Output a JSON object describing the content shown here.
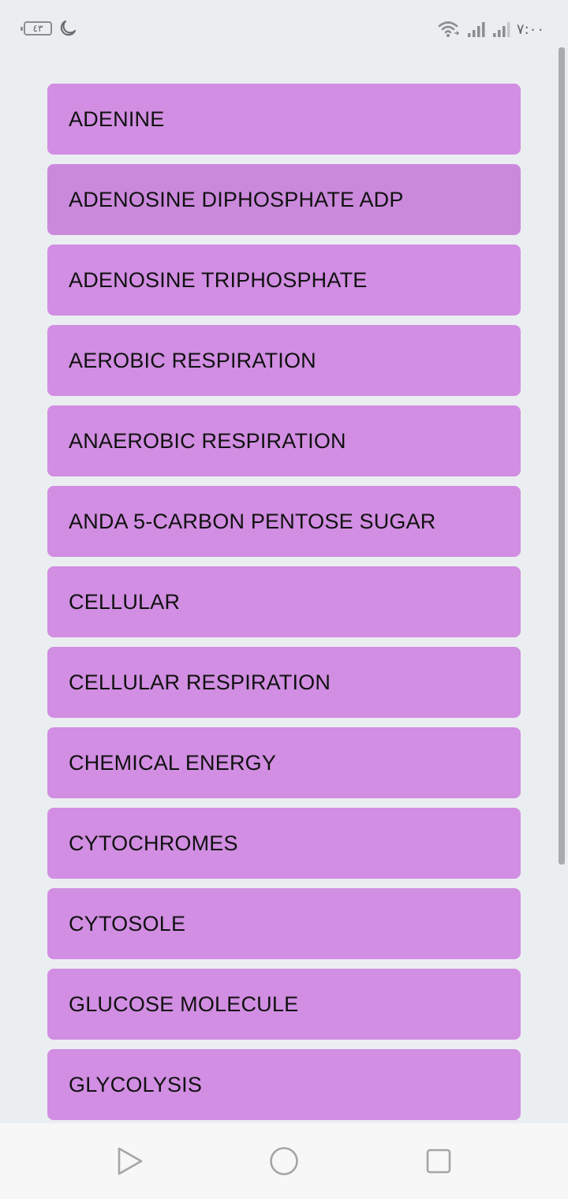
{
  "status_bar": {
    "battery_level": "٤٣",
    "time": "٧:٠٠",
    "icons": [
      "moon-icon",
      "wifi-icon",
      "signal-icon",
      "signal-icon"
    ]
  },
  "list": {
    "items": [
      "ADENINE",
      "ADENOSINE DIPHOSPHATE ADP",
      "ADENOSINE TRIPHOSPHATE",
      "AEROBIC RESPIRATION",
      "ANAEROBIC RESPIRATION",
      "ANDA 5-CARBON PENTOSE SUGAR",
      "CELLULAR",
      "CELLULAR RESPIRATION",
      "CHEMICAL ENERGY",
      "CYTOCHROMES",
      "CYTOSOLE",
      "GLUCOSE MOLECULE",
      "GLYCOLYSIS"
    ]
  },
  "nav_bar": {
    "icons": [
      "back-icon",
      "home-icon",
      "recents-icon"
    ]
  },
  "colors": {
    "background": "#ebeef0",
    "item_background": "#d18ee2",
    "item_text": "#111111",
    "nav_background": "#f7f7f7",
    "icon_gray": "#8a8d91"
  }
}
